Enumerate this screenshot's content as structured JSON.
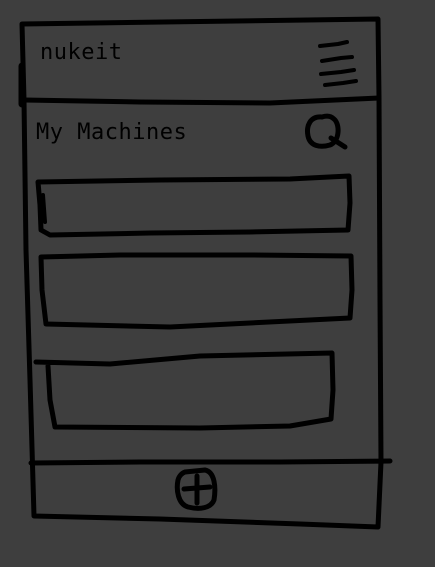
{
  "app": {
    "title": "nukeit"
  },
  "header": {
    "menu_icon": "hamburger-menu-icon"
  },
  "main": {
    "section_title": "My Machines",
    "search_icon": "search-icon",
    "machines": [
      {
        "label": ""
      },
      {
        "label": ""
      },
      {
        "label": ""
      }
    ]
  },
  "footer": {
    "add_icon": "plus-icon"
  },
  "colors": {
    "background": "#3e3e3e",
    "ink": "#000000"
  }
}
